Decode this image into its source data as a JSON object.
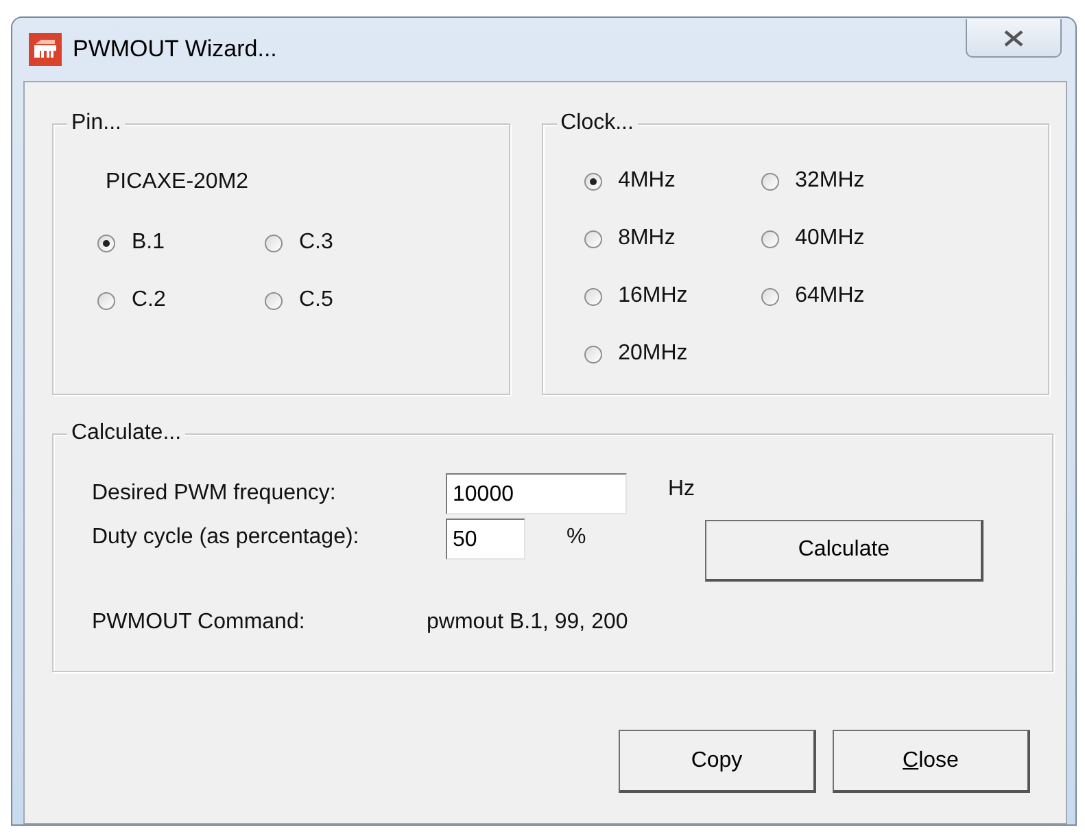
{
  "window": {
    "title": "PWMOUT Wizard..."
  },
  "pin_group": {
    "title": "Pin...",
    "chip": "PICAXE-20M2",
    "options": [
      {
        "label": "B.1",
        "selected": true
      },
      {
        "label": "C.3",
        "selected": false
      },
      {
        "label": "C.2",
        "selected": false
      },
      {
        "label": "C.5",
        "selected": false
      }
    ]
  },
  "clock_group": {
    "title": "Clock...",
    "options": [
      {
        "label": "4MHz",
        "selected": true
      },
      {
        "label": "32MHz",
        "selected": false
      },
      {
        "label": "8MHz",
        "selected": false
      },
      {
        "label": "40MHz",
        "selected": false
      },
      {
        "label": "16MHz",
        "selected": false
      },
      {
        "label": "64MHz",
        "selected": false
      },
      {
        "label": "20MHz",
        "selected": false
      }
    ]
  },
  "calculate_group": {
    "title": "Calculate...",
    "frequency": {
      "label": "Desired PWM frequency:",
      "value": "10000",
      "unit": "Hz"
    },
    "duty": {
      "label": "Duty cycle (as percentage):",
      "value": "50",
      "unit": "%"
    },
    "calculate_button": "Calculate",
    "command": {
      "label": "PWMOUT Command:",
      "value": "pwmout B.1, 99, 200"
    }
  },
  "buttons": [
    {
      "label": "Copy",
      "underline_first": false
    },
    {
      "label": "Close",
      "underline_first": true
    }
  ]
}
